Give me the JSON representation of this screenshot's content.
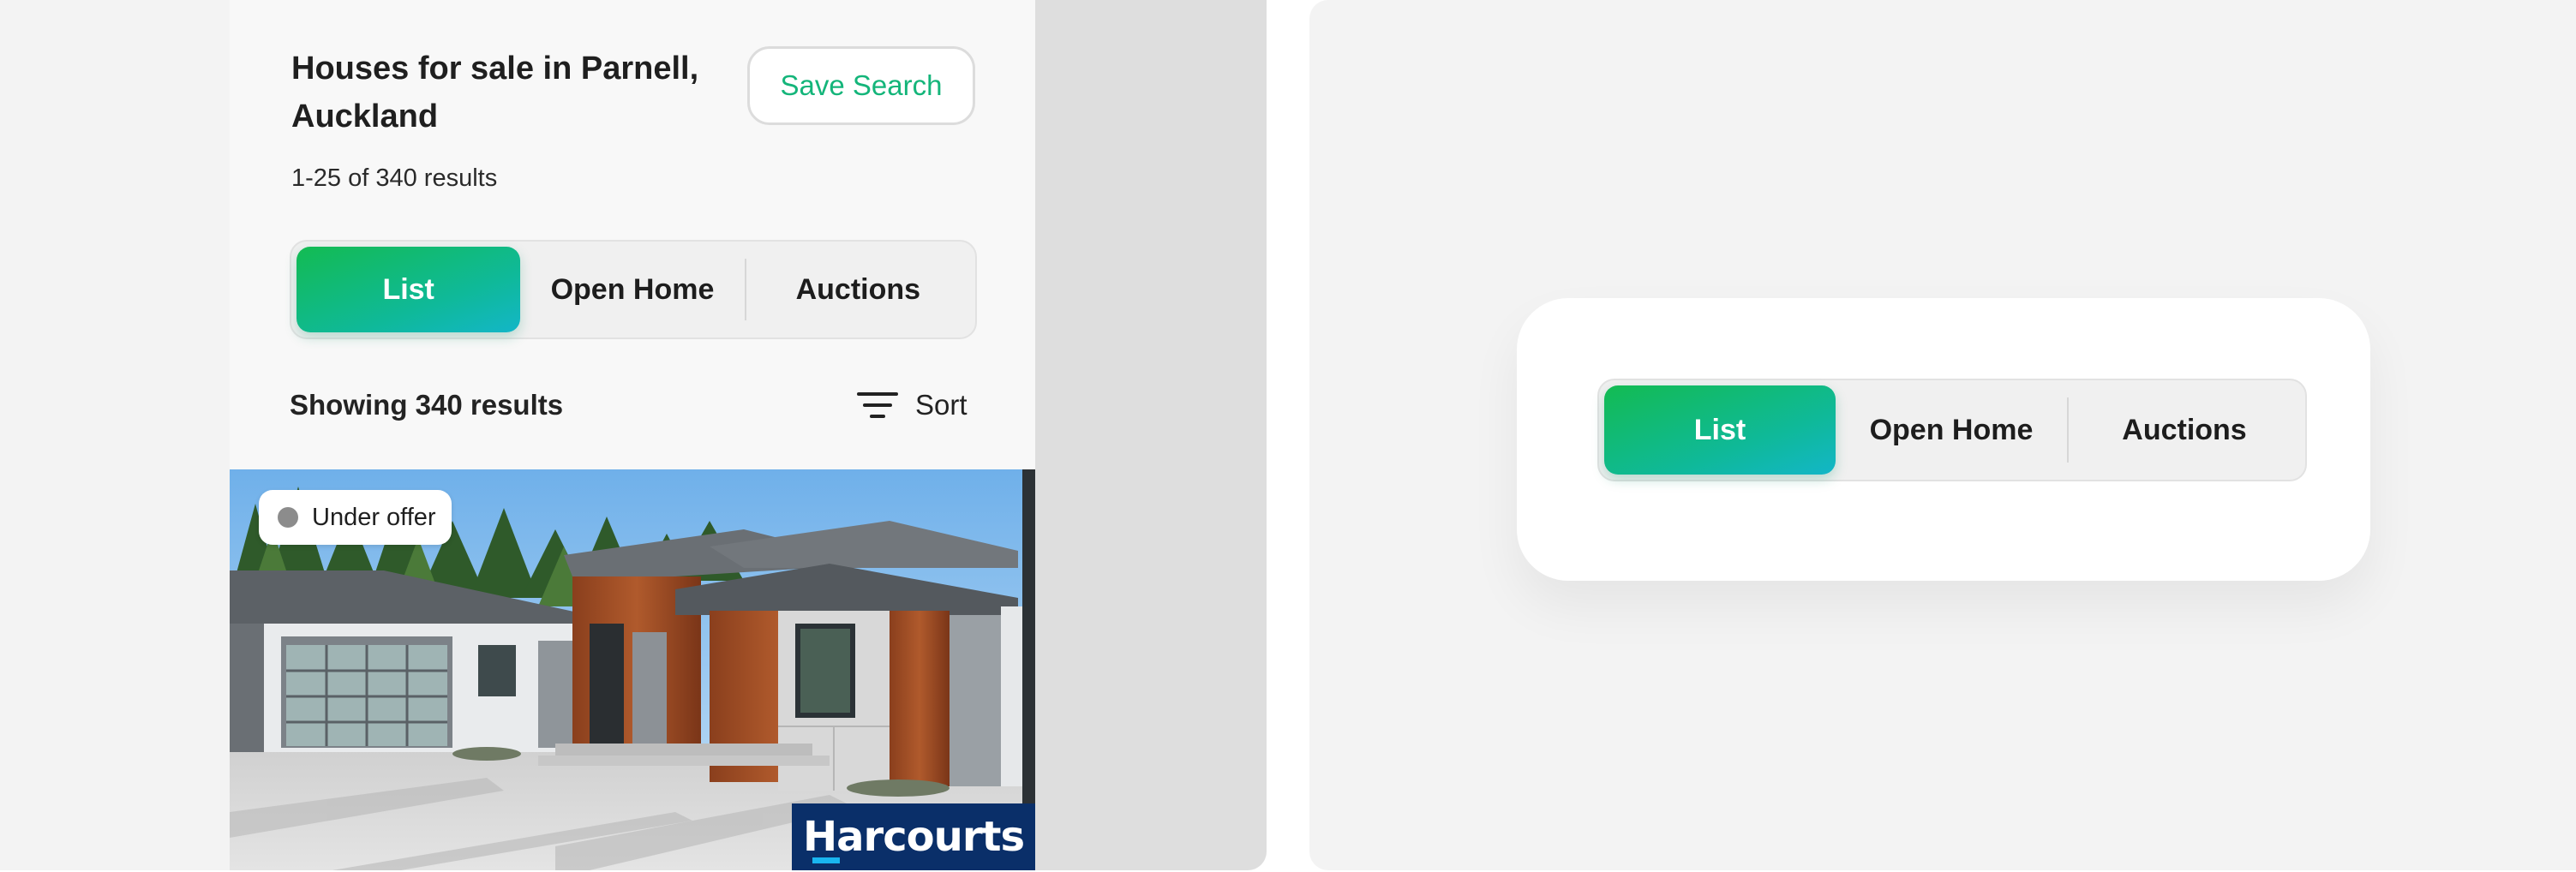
{
  "colors": {
    "accent_green": "#14b57a",
    "segment_gradient_start": "#13bb52",
    "segment_gradient_end": "#13b6c8",
    "brand_navy": "#0a2f69",
    "brand_blue": "#19b6f0"
  },
  "search": {
    "title": "Houses for sale in Parnell, Auckland",
    "save_label": "Save Search",
    "results_count": "1-25 of 340 results"
  },
  "view_toggle": {
    "selected": "List",
    "options": [
      "List",
      "Open Home",
      "Auctions"
    ]
  },
  "results_bar": {
    "showing": "Showing 340 results",
    "sort_label": "Sort",
    "sort_icon": "filter-lines-icon"
  },
  "listing": {
    "badge": "Under offer",
    "badge_dot_color": "#8c8c8c",
    "brand": "Harcourts"
  },
  "component_preview": {
    "selected": "List",
    "options": [
      "List",
      "Open Home",
      "Auctions"
    ]
  }
}
